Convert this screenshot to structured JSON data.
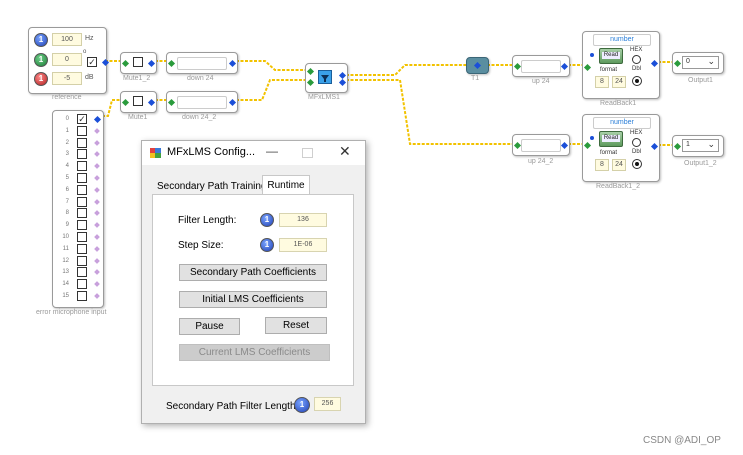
{
  "reference": {
    "freq_value": "100",
    "freq_unit": "Hz",
    "phase_value": "0",
    "phase_unit": "o",
    "gain_value": "-5",
    "gain_unit": "dB",
    "label": "reference"
  },
  "blocks": {
    "mute1": "Mute1_2",
    "mute2": "Mute1",
    "down1": "down 24",
    "down2": "down 24_2",
    "mfxlms": "MFxLMS1",
    "t1": "T1",
    "up1": "up 24",
    "up2": "up 24_2",
    "readback1": "ReadBack1",
    "readback2": "ReadBack1_2",
    "output1": "Output1",
    "output2": "Output1_2"
  },
  "readback": {
    "header": "number",
    "read_label": "Read",
    "format_label": "format",
    "hex_label": "HEX",
    "dbl_label": "Dbl",
    "format_a": "8",
    "format_b": "24"
  },
  "outputs": {
    "out1_value": "0",
    "out2_value": "1"
  },
  "error_mic": {
    "label": "error microphone input",
    "channels": [
      "0",
      "1",
      "2",
      "3",
      "4",
      "5",
      "6",
      "7",
      "8",
      "9",
      "10",
      "11",
      "12",
      "13",
      "14",
      "15"
    ]
  },
  "dialog": {
    "title": "MFxLMS Config...",
    "tabs": [
      "Secondary Path Training",
      "Runtime"
    ],
    "filter_length_label": "Filter Length:",
    "filter_length_value": "136",
    "step_size_label": "Step Size:",
    "step_size_value": "1E-06",
    "btn_secondary_coeffs": "Secondary Path Coefficients",
    "btn_initial_lms": "Initial LMS Coefficients",
    "btn_pause": "Pause",
    "btn_reset": "Reset",
    "btn_current_lms": "Current LMS Coefficients",
    "sp_filter_length_label": "Secondary Path Filter Length:",
    "sp_filter_length_value": "256"
  },
  "watermark": "CSDN @ADI_OP",
  "colors": {
    "wire": "#f2c200",
    "pin_blue": "#1b4fd8",
    "pin_green": "#2a9b3c",
    "readback_header": "#2b7fd8"
  }
}
